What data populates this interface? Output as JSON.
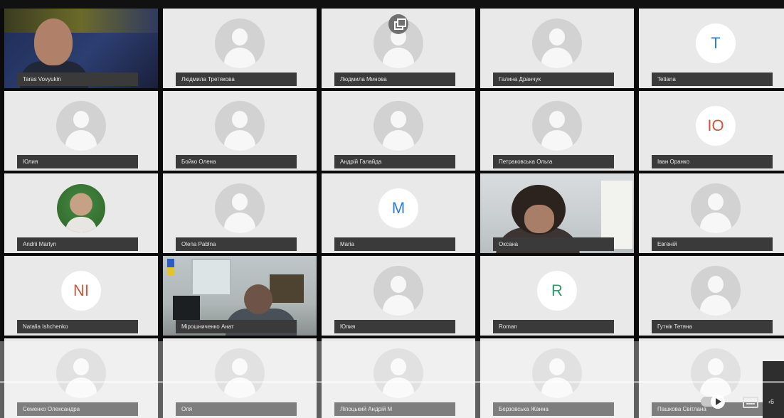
{
  "participants": [
    {
      "name": "Taras Vovyukin",
      "kind": "video",
      "variant": "video-1"
    },
    {
      "name": "Людмила Третякова",
      "kind": "placeholder"
    },
    {
      "name": "Людмила Минова",
      "kind": "placeholder",
      "icon": "multi-window-icon"
    },
    {
      "name": "Галина Дранчук",
      "kind": "placeholder"
    },
    {
      "name": "Tetiana",
      "kind": "initials",
      "initials": "T",
      "color": "#2d7fd3"
    },
    {
      "name": "Юлия",
      "kind": "placeholder"
    },
    {
      "name": "Бойко Олена",
      "kind": "placeholder"
    },
    {
      "name": "Андрій Галайда",
      "kind": "placeholder"
    },
    {
      "name": "Петраковська Ольга",
      "kind": "placeholder"
    },
    {
      "name": "Іван Оранко",
      "kind": "initials",
      "initials": "IO",
      "color": "#d0553b"
    },
    {
      "name": "Andrii Martyn",
      "kind": "photo"
    },
    {
      "name": "Olena Pablna",
      "kind": "placeholder"
    },
    {
      "name": "Maria",
      "kind": "initials",
      "initials": "M",
      "color": "#2d7fd3"
    },
    {
      "name": "Оксана",
      "kind": "video",
      "variant": "video-2"
    },
    {
      "name": "Евгеній",
      "kind": "placeholder"
    },
    {
      "name": "Natalia Ishchenko",
      "kind": "initials",
      "initials": "NI",
      "color": "#d0553b"
    },
    {
      "name": "Мірошниченко Анат",
      "kind": "video",
      "variant": "video-3"
    },
    {
      "name": "Юлия",
      "kind": "placeholder"
    },
    {
      "name": "Roman",
      "kind": "initials",
      "initials": "R",
      "color": "#2f9a6a"
    },
    {
      "name": "Гутнік Тетяна",
      "kind": "placeholder"
    },
    {
      "name": "Семенко Олександра",
      "kind": "placeholder"
    },
    {
      "name": "Оля",
      "kind": "placeholder"
    },
    {
      "name": "Ліпоцький Андрій М",
      "kind": "placeholder"
    },
    {
      "name": "Берзовська Жанна",
      "kind": "placeholder"
    },
    {
      "name": "Пашкова Світлана",
      "kind": "placeholder"
    }
  ],
  "player": {
    "progress": 0.0,
    "time_text": "‹6",
    "accent": "#ff0000"
  }
}
